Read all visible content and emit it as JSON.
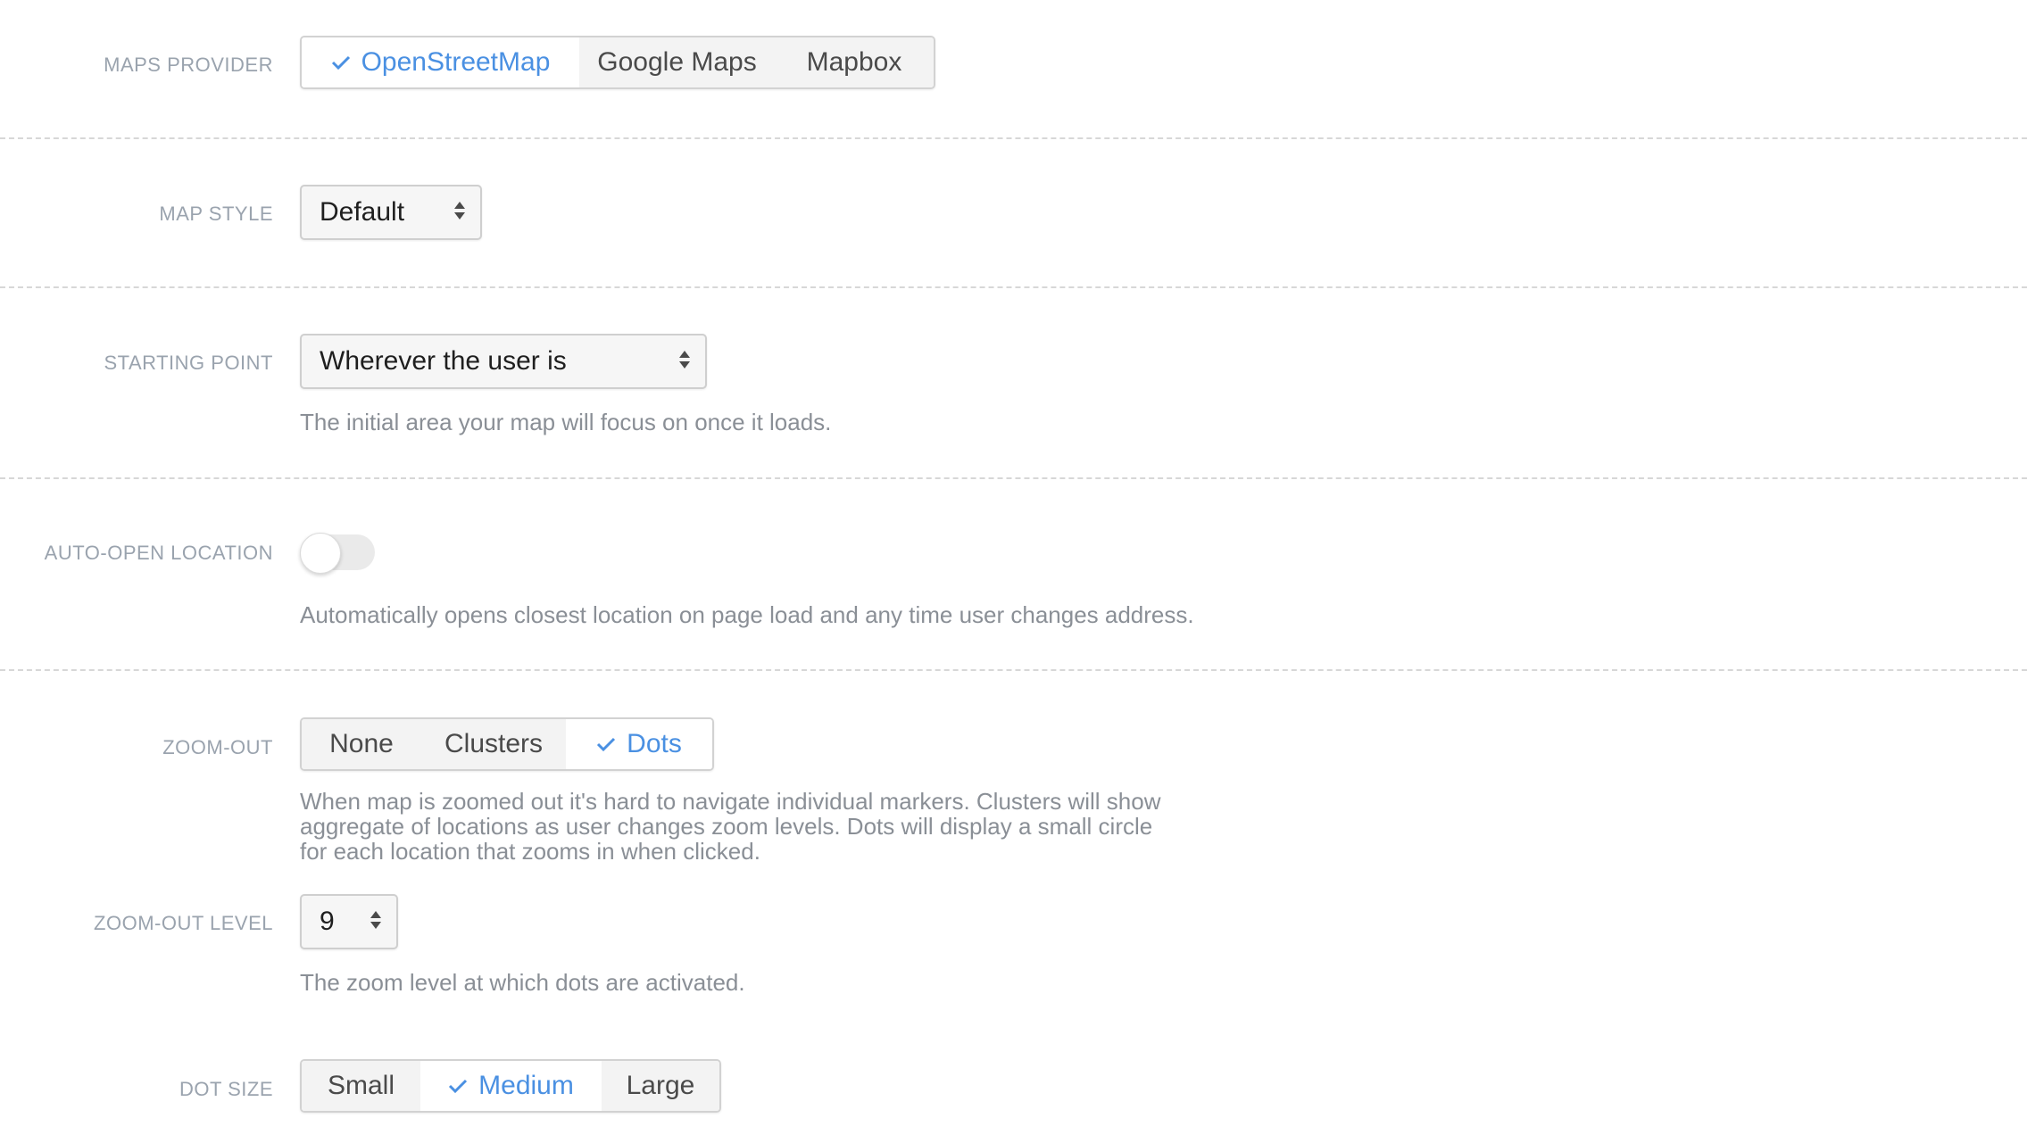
{
  "maps_provider": {
    "label": "MAPS PROVIDER",
    "options": [
      "OpenStreetMap",
      "Google Maps",
      "Mapbox"
    ],
    "selected": "OpenStreetMap"
  },
  "map_style": {
    "label": "MAP STYLE",
    "value": "Default"
  },
  "starting_point": {
    "label": "STARTING POINT",
    "value": "Wherever the user is",
    "description": "The initial area your map will focus on once it loads."
  },
  "auto_open": {
    "label": "AUTO-OPEN LOCATION",
    "enabled": false,
    "description": "Automatically opens closest location on page load and any time user changes address."
  },
  "zoom_out": {
    "label": "ZOOM-OUT",
    "options": [
      "None",
      "Clusters",
      "Dots"
    ],
    "selected": "Dots",
    "description": "When map is zoomed out it's hard to navigate individual markers. Clusters will show aggregate of locations as user changes zoom levels. Dots will display a small circle for each location that zooms in when clicked."
  },
  "zoom_out_level": {
    "label": "ZOOM-OUT LEVEL",
    "value": "9",
    "description": "The zoom level at which dots are activated."
  },
  "dot_size": {
    "label": "DOT SIZE",
    "options": [
      "Small",
      "Medium",
      "Large"
    ],
    "selected": "Medium"
  },
  "colors": {
    "accent": "#4a90e2",
    "label": "#9aa3ae",
    "description": "#8a8f96"
  },
  "icons": {
    "check": "check-icon",
    "select_arrows": "select-arrows-icon"
  }
}
